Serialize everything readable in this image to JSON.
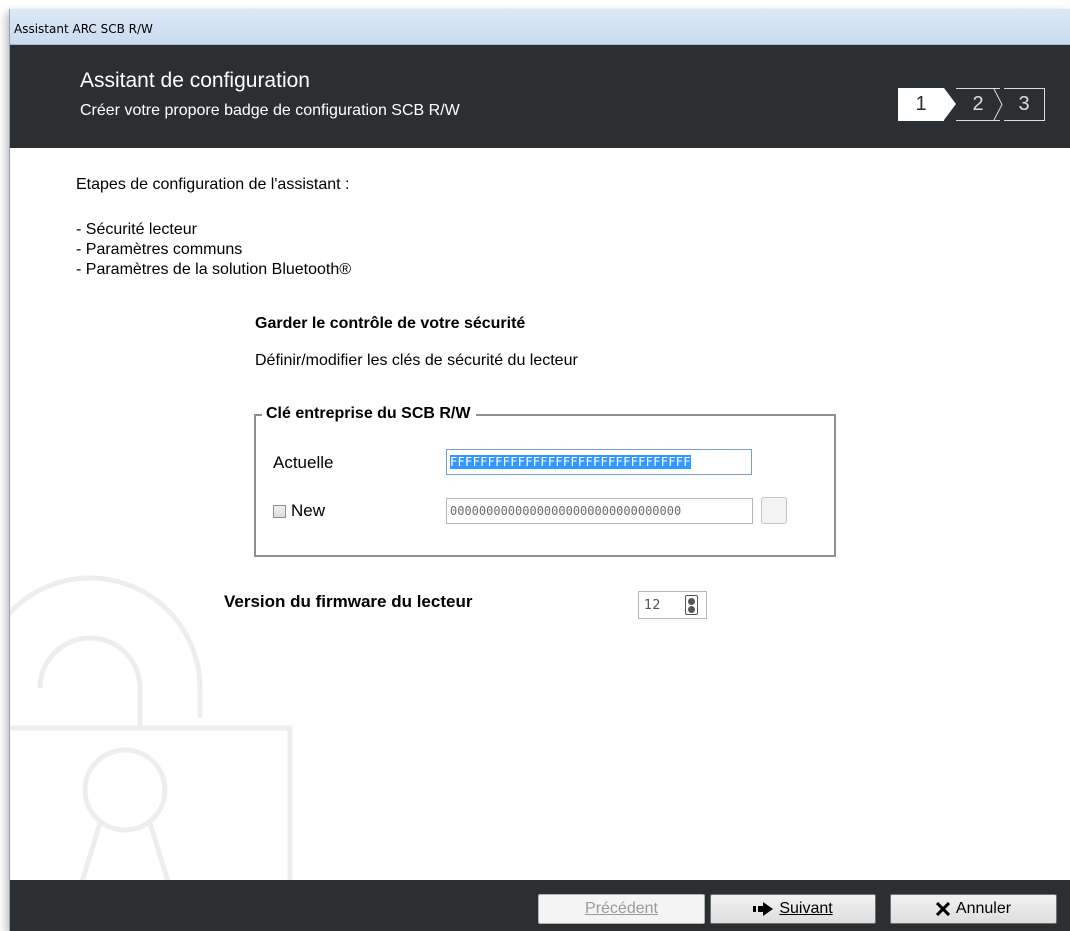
{
  "window": {
    "title": "Assistant ARC SCB R/W"
  },
  "header": {
    "title": "Assitant de configuration",
    "subtitle": "Créer votre propore badge de configuration SCB R/W",
    "steps": [
      "1",
      "2",
      "3"
    ],
    "active_step": 1
  },
  "content": {
    "intro": "Etapes de configuration de l'assistant :",
    "bullets": [
      "- Sécurité lecteur",
      "- Paramètres communs",
      "- Paramètres de la solution Bluetooth®"
    ],
    "section_title": "Garder le contrôle de votre sécurité",
    "section_desc": "Définir/modifier les clés de sécurité du lecteur",
    "groupbox": {
      "legend": "Clé entreprise du SCB R/W",
      "current_label": "Actuelle",
      "current_value": "FFFFFFFFFFFFFFFFFFFFFFFFFFFFFFFF",
      "new_label": "New",
      "new_checked": false,
      "new_value": "00000000000000000000000000000000"
    },
    "firmware_label": "Version du firmware du lecteur",
    "firmware_value": "12"
  },
  "footer": {
    "prev_label": "Précédent",
    "next_label": "Suivant",
    "cancel_label": "Annuler"
  },
  "colors": {
    "header_bg": "#2b2f32",
    "selection": "#3399ff"
  }
}
